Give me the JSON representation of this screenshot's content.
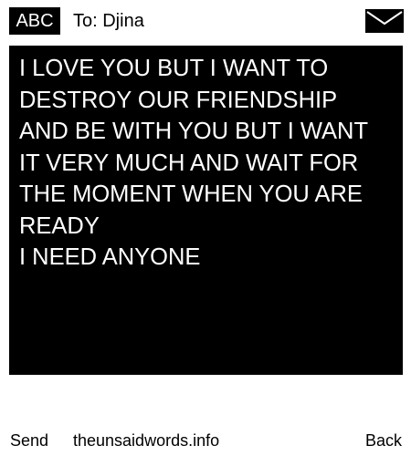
{
  "header": {
    "input_mode": "ABC",
    "recipient_line": "To: Djina",
    "envelope_icon": "envelope-icon"
  },
  "message": {
    "text": "I LOVE YOU BUT I WANT TO DESTROY OUR FRIENDSHIP AND BE WITH YOU BUT I WANT IT VERY MUCH AND WAIT FOR THE MOMENT WHEN YOU ARE READY\nI NEED ANYONE"
  },
  "footer": {
    "send_label": "Send",
    "site_label": "theunsaidwords.info",
    "back_label": "Back"
  },
  "colors": {
    "background": "#ffffff",
    "message_background": "#000000",
    "message_text": "#ffffff",
    "text": "#000000"
  }
}
